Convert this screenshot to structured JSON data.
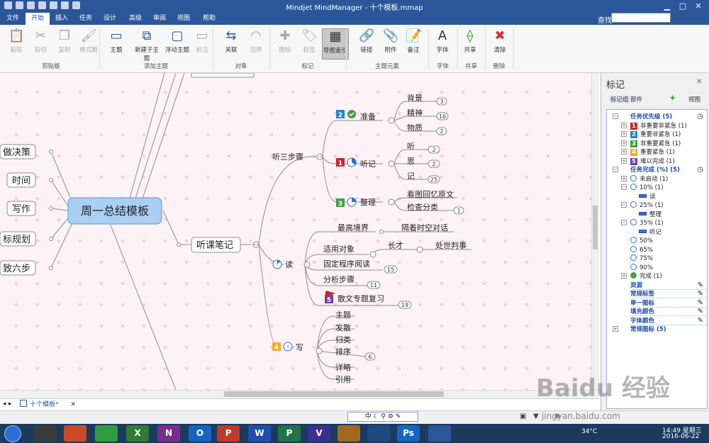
{
  "window": {
    "title": "Mindjet MindManager - 十个模板.mmap"
  },
  "tabs": [
    "文件",
    "开始",
    "插入",
    "任务",
    "设计",
    "高级",
    "审阅",
    "视图",
    "帮助"
  ],
  "search": {
    "label": "查找:",
    "value": ""
  },
  "ribbon": {
    "buttons": [
      {
        "label": "粘贴",
        "icon": "paste-icon",
        "glyph": "📋",
        "disabled": true
      },
      {
        "label": "剪切",
        "icon": "cut-icon",
        "glyph": "✂",
        "disabled": true
      },
      {
        "label": "复制",
        "icon": "copy-icon",
        "glyph": "❐",
        "disabled": true
      },
      {
        "label": "格式刷",
        "icon": "format-painter-icon",
        "glyph": "🖌",
        "disabled": true
      },
      {
        "label": "主题",
        "icon": "topic-icon",
        "glyph": "▭",
        "disabled": false
      },
      {
        "label": "新建子主题",
        "icon": "subtopic-icon",
        "glyph": "⧉",
        "disabled": false
      },
      {
        "label": "浮动主题",
        "icon": "floating-topic-icon",
        "glyph": "▢",
        "disabled": false
      },
      {
        "label": "标注",
        "icon": "callout-icon",
        "glyph": "▭",
        "disabled": true
      },
      {
        "label": "关联",
        "icon": "relationship-icon",
        "glyph": "⇆",
        "disabled": false
      },
      {
        "label": "边界",
        "icon": "boundary-icon",
        "glyph": "◠",
        "disabled": true
      },
      {
        "label": "图标",
        "icon": "icon-marker-icon",
        "glyph": "✚",
        "disabled": true
      },
      {
        "label": "标签",
        "icon": "tag-icon",
        "glyph": "🏷",
        "disabled": true
      },
      {
        "label": "导图索引",
        "icon": "map-index-icon",
        "glyph": "▦",
        "disabled": false,
        "selected": true
      },
      {
        "label": "链接",
        "icon": "link-icon",
        "glyph": "🔗",
        "disabled": false
      },
      {
        "label": "附件",
        "icon": "attachment-icon",
        "glyph": "📎",
        "disabled": false
      },
      {
        "label": "备注",
        "icon": "notes-icon",
        "glyph": "📝",
        "disabled": false
      },
      {
        "label": "字体",
        "icon": "font-icon",
        "glyph": "A",
        "disabled": false
      },
      {
        "label": "共享",
        "icon": "share-icon",
        "glyph": "⟠",
        "disabled": false
      },
      {
        "label": "清除",
        "icon": "clear-icon",
        "glyph": "✖",
        "disabled": false
      }
    ],
    "groups": [
      "剪贴板",
      "添加主题",
      "对象",
      "标记",
      "主题元素",
      "字体",
      "共享",
      "删除"
    ]
  },
  "map": {
    "central": "周一总结模板",
    "left": [
      "做决策",
      "时间",
      "写作",
      "标规划",
      "致六步"
    ],
    "top_partial": "",
    "main": "听课笔记",
    "b1": {
      "label": "听三步骤",
      "listen_prep": "准备",
      "prep_items": [
        "背景",
        "精神",
        "物质"
      ],
      "prep_counts": [
        "3",
        "16",
        "2"
      ],
      "note": "听记",
      "note_items": [
        "听",
        "思",
        "记"
      ],
      "note_counts": [
        "2",
        "2",
        "25"
      ],
      "org": "整理",
      "org_items": [
        "看图回忆原文",
        "检查分类"
      ],
      "org_count": "1"
    },
    "b2": {
      "label": "读",
      "items": [
        "最高境界",
        "适用对象",
        "固定程序阅读",
        "分析步骤",
        "散文专题复习"
      ],
      "far": "隔着时空对话",
      "long": "长才",
      "judge": "处世判事",
      "counts": [
        "15",
        "11",
        "19"
      ]
    },
    "b3": {
      "label": "写",
      "items": [
        "主题",
        "发散",
        "归类",
        "排序",
        "详略",
        "引用"
      ],
      "count": "6"
    },
    "priority_numbers": [
      "2",
      "1",
      "3",
      "5",
      "4"
    ]
  },
  "panel": {
    "title": "标记",
    "toolbar": [
      "标记组",
      "部件",
      "视图"
    ],
    "rows": [
      {
        "text": "任务优先级 (5)",
        "level": 0,
        "kind": "group",
        "sign": "−"
      },
      {
        "text": "非重要非紧急 (1)",
        "level": 1,
        "kind": "prio",
        "num": "1",
        "color": "#c62828",
        "sign": "+"
      },
      {
        "text": "重要非紧急 (1)",
        "level": 1,
        "kind": "prio",
        "num": "2",
        "color": "#1e88c8",
        "sign": "+"
      },
      {
        "text": "非重要紧急 (1)",
        "level": 1,
        "kind": "prio",
        "num": "3",
        "color": "#43a047",
        "sign": "+"
      },
      {
        "text": "重要紧急 (1)",
        "level": 1,
        "kind": "prio",
        "num": "4",
        "color": "#f9a825",
        "sign": "+"
      },
      {
        "text": "难以完成 (1)",
        "level": 1,
        "kind": "prio",
        "num": "5",
        "color": "#6a3fb5",
        "sign": "+"
      },
      {
        "text": "任务完成 (%) (5)",
        "level": 0,
        "kind": "group",
        "sign": "−"
      },
      {
        "text": "未启动 (1)",
        "level": 1,
        "kind": "prog",
        "sign": "+"
      },
      {
        "text": "10% (1)",
        "level": 1,
        "kind": "prog",
        "sign": "−"
      },
      {
        "text": "读",
        "level": 2,
        "kind": "bar"
      },
      {
        "text": "25% (1)",
        "level": 1,
        "kind": "prog",
        "sign": "−"
      },
      {
        "text": "整理",
        "level": 2,
        "kind": "bar"
      },
      {
        "text": "35% (1)",
        "level": 1,
        "kind": "prog",
        "sign": "−"
      },
      {
        "text": "听记",
        "level": 2,
        "kind": "bar"
      },
      {
        "text": "50%",
        "level": 1,
        "kind": "prog"
      },
      {
        "text": "65%",
        "level": 1,
        "kind": "prog"
      },
      {
        "text": "75%",
        "level": 1,
        "kind": "prog"
      },
      {
        "text": "90%",
        "level": 1,
        "kind": "prog"
      },
      {
        "text": "完成 (1)",
        "level": 1,
        "kind": "done",
        "sign": "+"
      },
      {
        "text": "资源",
        "level": 0,
        "kind": "link"
      },
      {
        "text": "常规标签",
        "level": 0,
        "kind": "link"
      },
      {
        "text": "单一图标",
        "level": 0,
        "kind": "link"
      },
      {
        "text": "填充颜色",
        "level": 0,
        "kind": "link"
      },
      {
        "text": "字体颜色",
        "level": 0,
        "kind": "link"
      },
      {
        "text": "常规图标 (5)",
        "level": 0,
        "kind": "group",
        "sign": "+"
      }
    ]
  },
  "doc_tab": "十个模板*",
  "statusbar": {
    "mode": "中",
    "zoom": "",
    "percent": ""
  },
  "taskbar": {
    "time": "14:49 星期三",
    "date": "2016-06-22",
    "temp": "34°C",
    "apps": [
      "X",
      "N",
      "O",
      "P",
      "W",
      "P",
      "V",
      "Ps"
    ]
  },
  "watermark": {
    "brand": "Baidu 经验",
    "url": "jingyan.baidu.com"
  }
}
